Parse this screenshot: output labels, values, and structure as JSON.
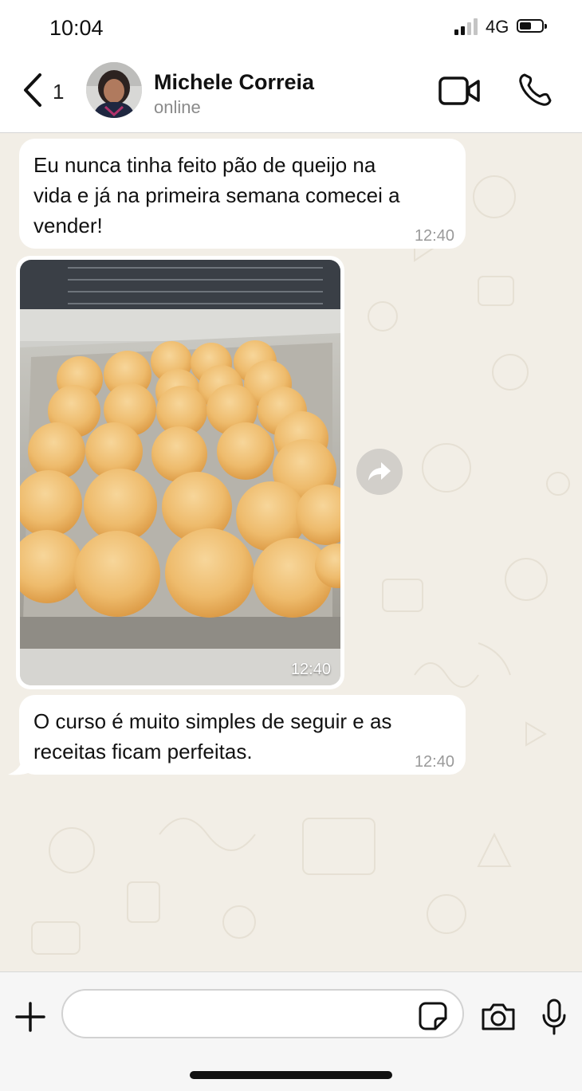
{
  "status_bar": {
    "time": "10:04",
    "network": "4G",
    "signal_icon": "signal-bars-icon",
    "battery_icon": "battery-icon"
  },
  "header": {
    "back_count": "1",
    "contact_name": "Michele Correia",
    "contact_status": "online",
    "icons": [
      "back-chevron-icon",
      "video-camera-icon",
      "phone-icon"
    ]
  },
  "messages": [
    {
      "type": "text",
      "text_lines": [
        "Eu nunca tinha feito pão de queijo na",
        "vida e já na primeira semana comecei a",
        "vender!"
      ],
      "time": "12:40"
    },
    {
      "type": "image",
      "image_description": "tray of baked cheese bread",
      "time": "12:40"
    },
    {
      "type": "text",
      "text_lines": [
        "O curso é muito simples de seguir e as",
        "receitas ficam perfeitas."
      ],
      "time": "12:40"
    }
  ],
  "input_bar": {
    "placeholder": "",
    "icons": [
      "plus-icon",
      "sticker-icon",
      "camera-icon",
      "microphone-icon"
    ]
  },
  "colors": {
    "chat_background": "#f2eee6",
    "bubble": "#ffffff",
    "time_text": "#9a9a9a",
    "header_bg": "#ffffff",
    "input_bar_bg": "#f6f6f6"
  }
}
